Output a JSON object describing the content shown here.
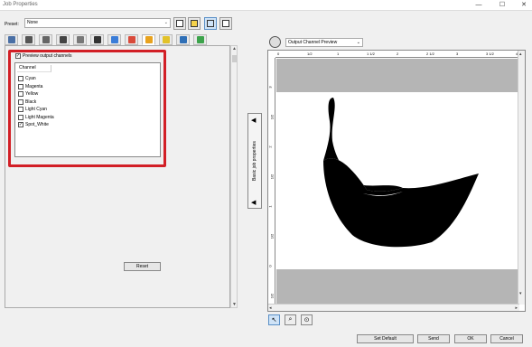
{
  "window": {
    "title": "Job Properties",
    "min": "—",
    "max": "☐",
    "close": "✕"
  },
  "preset": {
    "label": "Preset:",
    "value": "None",
    "arrow": "⌄"
  },
  "toolbar": {
    "icons": [
      "save-icon",
      "save-as-icon",
      "abc-icon",
      "print-queue-icon"
    ]
  },
  "tabs": [
    {
      "icon": "layout-icon",
      "color": "#4a6fa5"
    },
    {
      "icon": "printer-icon",
      "color": "#555555"
    },
    {
      "icon": "media-icon",
      "color": "#666666"
    },
    {
      "icon": "printer-settings-icon",
      "color": "#444444"
    },
    {
      "icon": "grid-icon",
      "color": "#777777"
    },
    {
      "icon": "target-icon",
      "color": "#333333"
    },
    {
      "icon": "color-bars-icon",
      "color": "#3b7dd8"
    },
    {
      "icon": "ink-icon",
      "color": "#d94a3a"
    },
    {
      "icon": "channels-icon",
      "color": "#e8a21e"
    },
    {
      "icon": "color-swatches-icon",
      "color": "#e2c229"
    },
    {
      "icon": "shape-icon",
      "color": "#2f6fb6"
    },
    {
      "icon": "correction-icon",
      "color": "#3ca34b"
    }
  ],
  "output_channels": {
    "preview_label": "Preview output channels",
    "preview_checked": "✓",
    "column_header": "Channel",
    "items": [
      {
        "label": "Cyan",
        "mark": ""
      },
      {
        "label": "Magenta",
        "mark": ""
      },
      {
        "label": "Yellow",
        "mark": ""
      },
      {
        "label": "Black",
        "mark": ""
      },
      {
        "label": "Light Cyan",
        "mark": ""
      },
      {
        "label": "Light Magenta",
        "mark": ""
      },
      {
        "label": "Spot_White",
        "mark": "✓"
      }
    ],
    "reset_label": "Reset"
  },
  "side_tab": {
    "label": "Basic job properties",
    "up": "◀",
    "down": "◀"
  },
  "preview": {
    "mode": "Output Channel Preview",
    "arrow": "⌄",
    "ruler_h": [
      "0",
      "1/2",
      "1",
      "1 1/2",
      "2",
      "2 1/2",
      "3",
      "3 1/2",
      "4"
    ],
    "ruler_v": [
      "3",
      "1/2",
      "2",
      "1/2",
      "1",
      "1/2",
      "0",
      "1/2"
    ]
  },
  "tools": [
    "arrow-icon",
    "zoom-icon",
    "pan-icon"
  ],
  "buttons": {
    "set_default": "Set Default",
    "send": "Send",
    "ok": "OK",
    "cancel": "Cancel"
  }
}
